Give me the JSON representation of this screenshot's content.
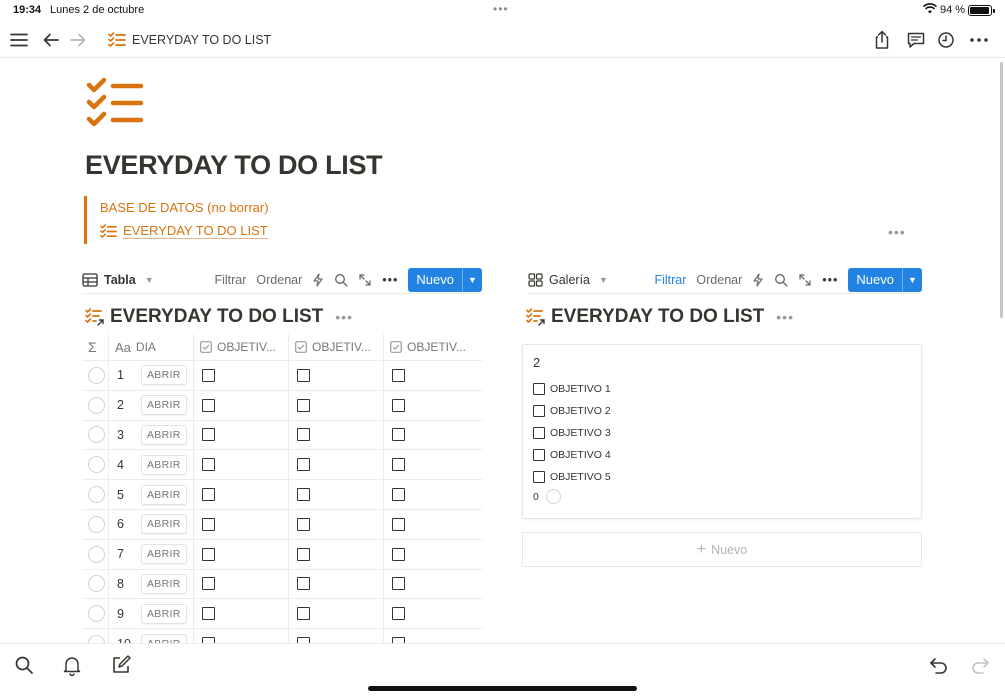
{
  "status_bar": {
    "time": "19:34",
    "date": "Lunes 2 de octubre",
    "battery": "94 %",
    "battery_level": 0.94,
    "dots": "•••"
  },
  "nav": {
    "breadcrumb_title": "EVERYDAY TO DO LIST"
  },
  "page": {
    "title": "EVERYDAY TO DO LIST",
    "callout_line1": "BASE DE DATOS (no borrar)",
    "callout_link": "EVERYDAY TO DO LIST",
    "more": "•••"
  },
  "table_view": {
    "view_name": "Tabla",
    "filter": "Filtrar",
    "sort": "Ordenar",
    "new_button": "Nuevo",
    "db_title": "EVERYDAY TO DO LIST",
    "more": "•••",
    "columns": [
      "Σ",
      "DIA",
      "OBJETIV...",
      "OBJETIV...",
      "OBJETIV..."
    ],
    "column_icon_text": "Aa",
    "rows": [
      {
        "dia": "1",
        "open": "ABRIR"
      },
      {
        "dia": "2",
        "open": "ABRIR"
      },
      {
        "dia": "3",
        "open": "ABRIR"
      },
      {
        "dia": "4",
        "open": "ABRIR"
      },
      {
        "dia": "5",
        "open": "ABRIR"
      },
      {
        "dia": "6",
        "open": "ABRIR"
      },
      {
        "dia": "7",
        "open": "ABRIR"
      },
      {
        "dia": "8",
        "open": "ABRIR"
      },
      {
        "dia": "9",
        "open": "ABRIR"
      },
      {
        "dia": "10",
        "open": "ABRIR"
      }
    ]
  },
  "gallery_view": {
    "view_name": "Galería",
    "filter": "Filtrar",
    "sort": "Ordenar",
    "new_button": "Nuevo",
    "db_title": "EVERYDAY TO DO LIST",
    "more": "•••",
    "card": {
      "title": "2",
      "objectives": [
        "OBJETIVO 1",
        "OBJETIVO 2",
        "OBJETIVO 3",
        "OBJETIVO 4",
        "OBJETIVO 5"
      ],
      "count": "0"
    },
    "add_new": "Nuevo",
    "add_plus": "+"
  },
  "colors": {
    "accent": "#d9730d",
    "primary": "#2383e2",
    "text": "#37352f",
    "muted": "#787774"
  }
}
